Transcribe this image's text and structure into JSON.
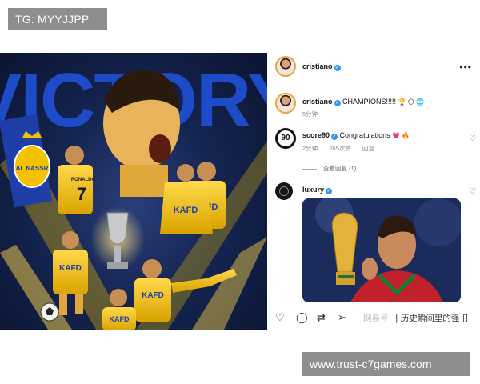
{
  "watermark_tag": "TG: MYYJJPP",
  "url_tag": "www.trust-c7games.com",
  "poster": {
    "headline": "VICTORY",
    "shirt_name": "RONALDO",
    "shirt_number": "7",
    "sponsor": "KAFD"
  },
  "post": {
    "author": "cristiano",
    "comments": [
      {
        "user": "cristiano",
        "text": "CHAMPIONS!!!!!",
        "emojis": "🏆 🌕 🌐",
        "time": "5分钟"
      },
      {
        "user": "score90",
        "avatar_text": "90",
        "text": "Congratulations",
        "emojis": "💗 🔥",
        "time": "2分钟",
        "likes": "265次赞",
        "reply": "回复",
        "view_replies": "查看回复 (1)"
      },
      {
        "user": "luxury"
      }
    ]
  },
  "actions": {
    "source_mark": "网易号",
    "source_title": "| 历史瞬间里的强"
  },
  "colors": {
    "verified": "#3897f0",
    "poster_gold": "#f2c200",
    "poster_blue": "#1e3fa8",
    "tag_gray": "#8e8e8e"
  }
}
